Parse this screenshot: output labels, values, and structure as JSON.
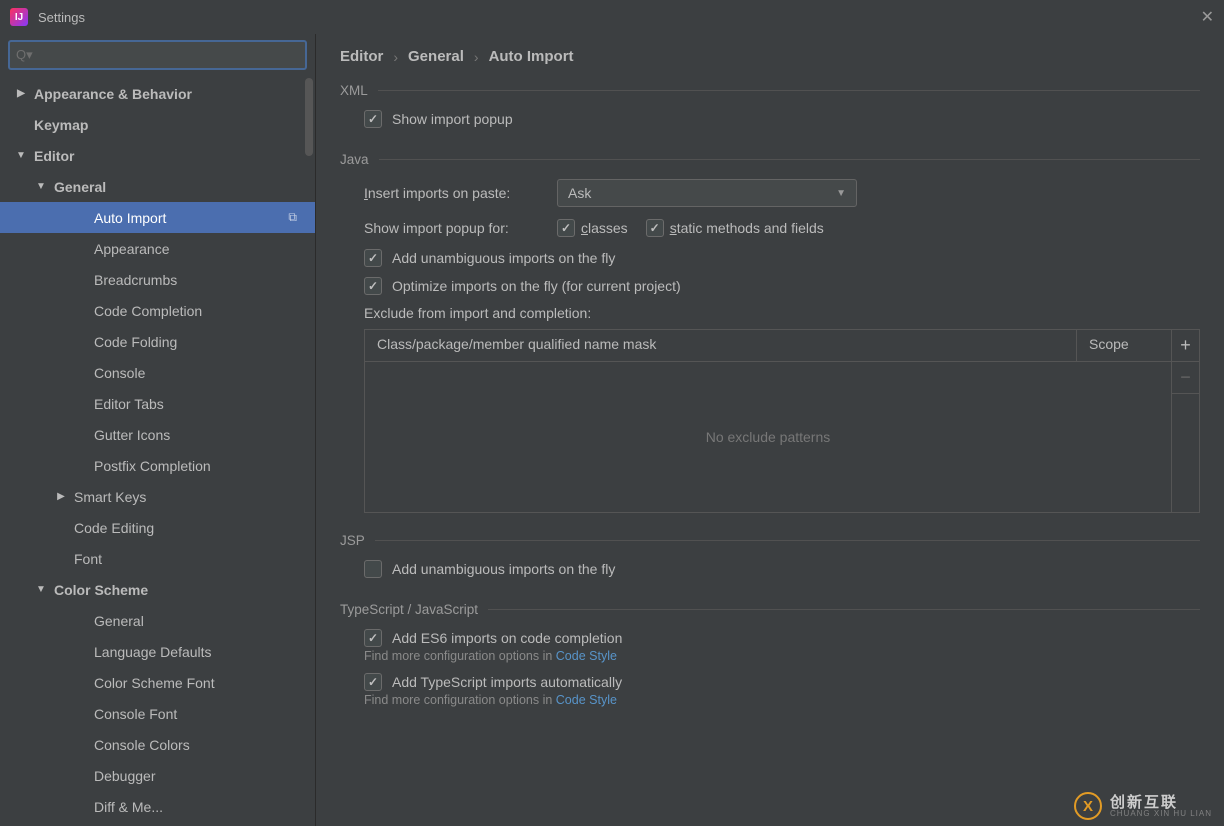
{
  "window": {
    "title": "Settings"
  },
  "sidebar": {
    "items": [
      {
        "label": "Appearance & Behavior",
        "level": 0,
        "arrow": "right"
      },
      {
        "label": "Keymap",
        "level": 0,
        "arrow": "none"
      },
      {
        "label": "Editor",
        "level": 0,
        "arrow": "down"
      },
      {
        "label": "General",
        "level": 1,
        "arrow": "down"
      },
      {
        "label": "Auto Import",
        "level": 2,
        "selected": true,
        "copy": true
      },
      {
        "label": "Appearance",
        "level": 2
      },
      {
        "label": "Breadcrumbs",
        "level": 2
      },
      {
        "label": "Code Completion",
        "level": 2
      },
      {
        "label": "Code Folding",
        "level": 2
      },
      {
        "label": "Console",
        "level": 2
      },
      {
        "label": "Editor Tabs",
        "level": 2
      },
      {
        "label": "Gutter Icons",
        "level": 2
      },
      {
        "label": "Postfix Completion",
        "level": 2
      },
      {
        "label": "Smart Keys",
        "level": "2b",
        "arrow": "right"
      },
      {
        "label": "Code Editing",
        "level": "2b"
      },
      {
        "label": "Font",
        "level": "2b"
      },
      {
        "label": "Color Scheme",
        "level": 1,
        "arrow": "down"
      },
      {
        "label": "General",
        "level": 2
      },
      {
        "label": "Language Defaults",
        "level": 2
      },
      {
        "label": "Color Scheme Font",
        "level": 2
      },
      {
        "label": "Console Font",
        "level": 2
      },
      {
        "label": "Console Colors",
        "level": 2
      },
      {
        "label": "Debugger",
        "level": 2
      },
      {
        "label": "Diff & Me...",
        "level": 2
      }
    ]
  },
  "breadcrumb": [
    "Editor",
    "General",
    "Auto Import"
  ],
  "sections": {
    "xml": {
      "title": "XML",
      "show_popup": "Show import popup"
    },
    "java": {
      "title": "Java",
      "insert_paste_label": "Insert imports on paste:",
      "insert_u": "I",
      "insert_paste_value": "Ask",
      "show_popup_for": "Show import popup for:",
      "classes": "lasses",
      "classes_u": "c",
      "static_methods": "tatic methods and fields",
      "static_u": "s",
      "add_unambiguous": "Add unambiguous imports on the fly",
      "optimize": "Optimize imports on the fly (for current project)",
      "exclude_label": "Exclude from import and completion:",
      "col1": "Class/package/member qualified name mask",
      "col2": "Scope",
      "empty": "No exclude patterns"
    },
    "jsp": {
      "title": "JSP",
      "add_unambiguous": "Add unambiguous imports on the fly"
    },
    "ts": {
      "title": "TypeScript / JavaScript",
      "add_es6": "Add ES6 imports on code completion",
      "hint1_prefix": "Find more configuration options in ",
      "hint1_link": "Code Style",
      "add_ts": "Add TypeScript imports automatically",
      "hint2_prefix": "Find more configuration options in ",
      "hint2_link": "Code Style"
    }
  },
  "watermark": {
    "cn": "创新互联",
    "en": "CHUANG XIN HU LIAN"
  }
}
